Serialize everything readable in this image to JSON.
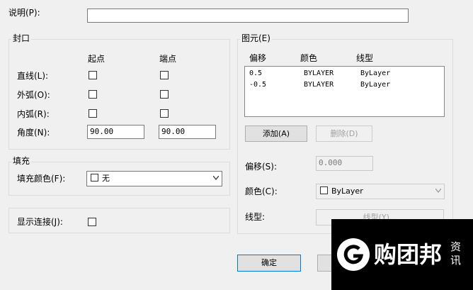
{
  "description": {
    "label": "说明(P):",
    "value": ""
  },
  "caps": {
    "title": "封口",
    "col_start": "起点",
    "col_end": "端点",
    "rows": [
      {
        "label": "直线(L):"
      },
      {
        "label": "外弧(O):"
      },
      {
        "label": "内弧(R):"
      }
    ],
    "angle_label": "角度(N):",
    "angle_start": "90.00",
    "angle_end": "90.00"
  },
  "fill": {
    "title": "填充",
    "label": "填充颜色(F):",
    "value": "无"
  },
  "display_joints": {
    "label": "显示连接(J):"
  },
  "elements": {
    "title": "图元(E)",
    "headers": [
      "偏移",
      "颜色",
      "线型"
    ],
    "rows": [
      {
        "offset": "0.5",
        "color": "BYLAYER",
        "linetype": "ByLayer"
      },
      {
        "offset": "-0.5",
        "color": "BYLAYER",
        "linetype": "ByLayer"
      }
    ],
    "add_button": "添加(A)",
    "delete_button": "删除(D)",
    "offset_label": "偏移(S):",
    "offset_value": "0.000",
    "color_label": "颜色(C):",
    "color_value": "ByLayer",
    "linetype_label": "线型:",
    "linetype_button": "线型(Y)..."
  },
  "footer": {
    "ok_button": "确定"
  },
  "watermark": {
    "text": "购团邦",
    "side": "资讯"
  }
}
